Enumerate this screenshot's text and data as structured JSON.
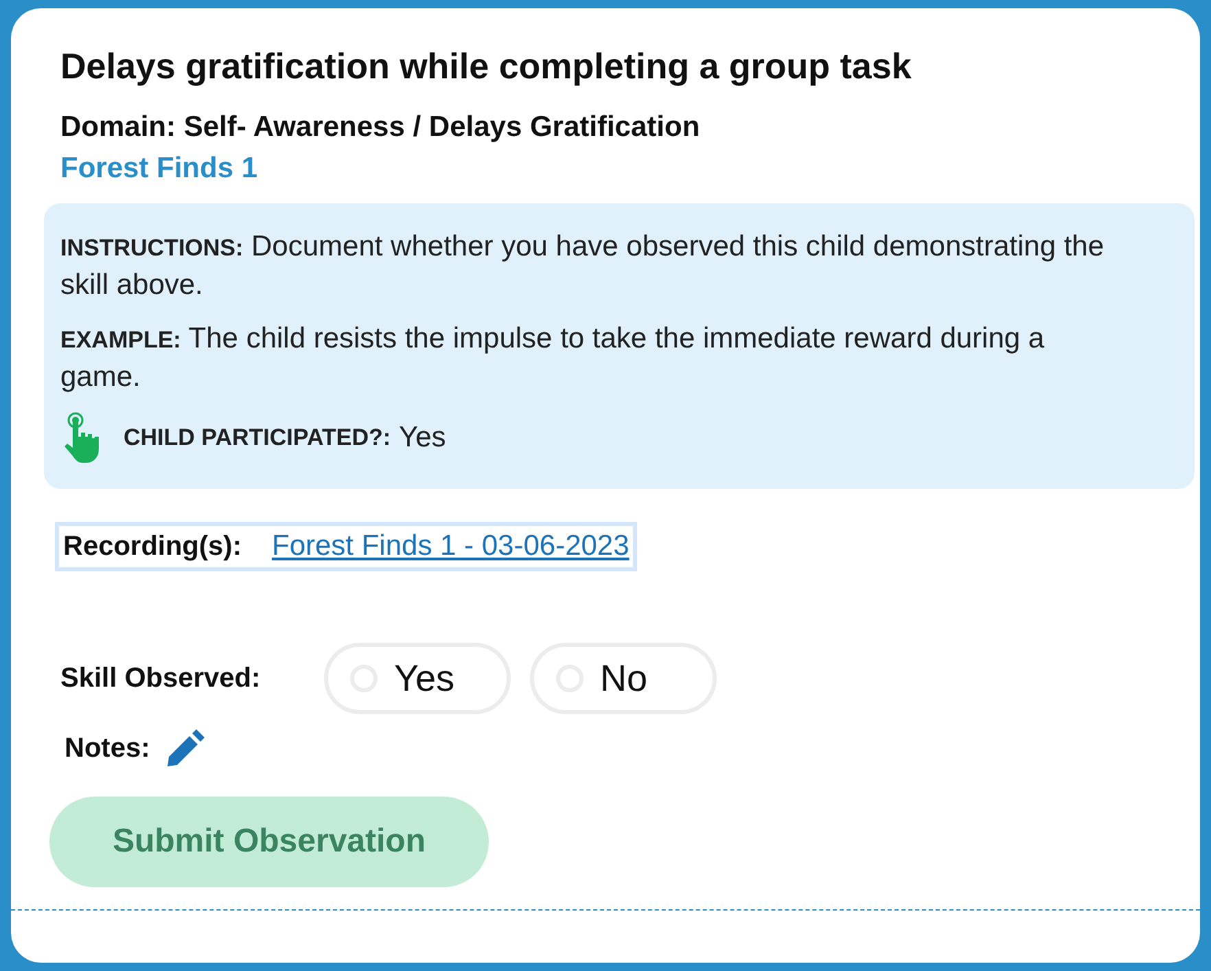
{
  "title": "Delays gratification while completing a group task",
  "domain": "Domain: Self- Awareness / Delays Gratification",
  "activity": "Forest Finds 1",
  "info": {
    "instructions": "**INSTRUCTIONS:** Document whether you have observed this child demonstrating the skill above.",
    "example": "**EXAMPLE:** The child resists the impulse to take the immediate reward during a game.",
    "participated_label": "CHILD PARTICIPATED?:",
    "participated_value": "Yes"
  },
  "recordings": {
    "label": "Recording(s):",
    "link": "Forest Finds 1 - 03-06-2023"
  },
  "skill_observed": {
    "label": "Skill Observed:",
    "options": [
      {
        "label": "Yes",
        "selected": false
      },
      {
        "label": "No",
        "selected": false
      }
    ]
  },
  "notes": {
    "label": "Notes:"
  },
  "submit": {
    "label": "Submit Observation",
    "disabled": true
  }
}
